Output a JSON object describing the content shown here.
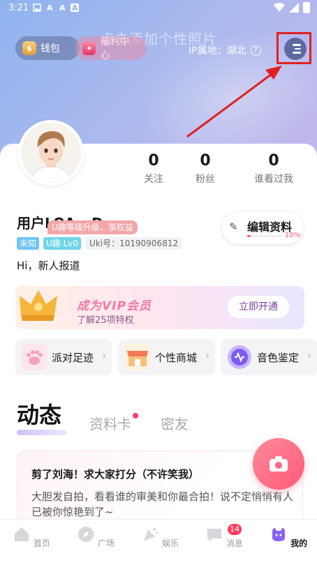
{
  "status_bar": {
    "time": "3:21",
    "left_glyphs": [
      "image-icon",
      "a-icon",
      "a-icon",
      "a-box-icon"
    ],
    "right_icons": [
      "wifi-icon",
      "signal-icon",
      "battery-icon"
    ]
  },
  "header": {
    "add_photo_hint": "点击添加个性照片",
    "wallet_label": "钱包",
    "welfare_label": "福利中心",
    "ip_label": "IP属地：湖北",
    "help_symbol": "?"
  },
  "stats": [
    {
      "value": "0",
      "label": "关注"
    },
    {
      "value": "0",
      "label": "粉丝"
    },
    {
      "value": "0",
      "label": "谁看过我"
    }
  ],
  "profile": {
    "username": "用户LOA...D",
    "upgrade_tip": "U趣等级升级，享权益",
    "badge_unknown": "未知",
    "badge_level": "U趣 Lv0",
    "uki_id": "Uki号：10190906812",
    "greeting": "Hi，新人报道",
    "edit_label": "编辑资料",
    "edit_progress_text": "10%",
    "edit_progress": 0.1
  },
  "vip": {
    "title": "成为VIP会员",
    "subtitle": "了解25项特权",
    "button": "立即开通"
  },
  "features": [
    {
      "label": "派对足迹",
      "icon": "paw-icon"
    },
    {
      "label": "个性商城",
      "icon": "shop-icon"
    },
    {
      "label": "音色鉴定",
      "icon": "voice-icon"
    }
  ],
  "tabs": {
    "active": "动态",
    "items": [
      "资料卡",
      "密友"
    ]
  },
  "post": {
    "title": "剪了刘海！求大家打分（不许笑我）",
    "body": "大胆发自拍，看看谁的审美和你最合拍！说不定悄悄有人已被你惊艳到了~"
  },
  "bottom_nav": [
    {
      "label": "首页",
      "icon": "home-icon"
    },
    {
      "label": "广场",
      "icon": "compass-icon"
    },
    {
      "label": "娱乐",
      "icon": "party-icon"
    },
    {
      "label": "消息",
      "icon": "message-icon",
      "badge": "14"
    },
    {
      "label": "我的",
      "icon": "profile-icon",
      "active": true
    }
  ],
  "colors": {
    "accent": "#ff5a76",
    "header_start": "#8fb3ef",
    "header_end": "#c3b7ec",
    "highlight_box": "#e02020"
  }
}
